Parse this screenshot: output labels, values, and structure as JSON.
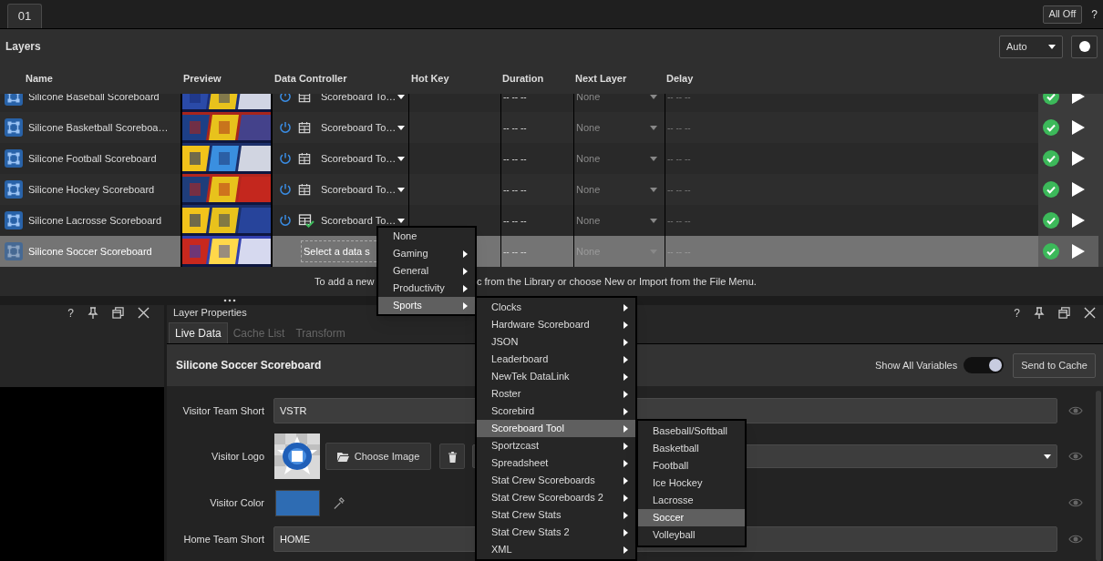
{
  "top_tab": {
    "label": "01",
    "selected": true
  },
  "all_off_button": "All Off",
  "help": "?",
  "layers": {
    "title": "Layers",
    "mode": "Auto"
  },
  "columns": [
    "Name",
    "Preview",
    "Data Controller",
    "Hot Key",
    "Duration",
    "Next Layer",
    "Delay"
  ],
  "rows": [
    {
      "name": "Silicone Baseball Scoreboard",
      "selected": false,
      "controller": {
        "kind": "dropdown",
        "label": "Scoreboard To…",
        "linked": false
      },
      "duration": "-- -- --",
      "next_layer": "None",
      "delay": "-- -- --"
    },
    {
      "name": "Silicone Basketball Scoreboa…",
      "selected": false,
      "controller": {
        "kind": "dropdown",
        "label": "Scoreboard To…",
        "linked": false
      },
      "duration": "-- -- --",
      "next_layer": "None",
      "delay": "-- -- --"
    },
    {
      "name": "Silicone Football Scoreboard",
      "selected": false,
      "controller": {
        "kind": "dropdown",
        "label": "Scoreboard To…",
        "linked": false
      },
      "duration": "-- -- --",
      "next_layer": "None",
      "delay": "-- -- --"
    },
    {
      "name": "Silicone Hockey Scoreboard",
      "selected": false,
      "controller": {
        "kind": "dropdown",
        "label": "Scoreboard To…",
        "linked": false
      },
      "duration": "-- -- --",
      "next_layer": "None",
      "delay": "-- -- --"
    },
    {
      "name": "Silicone Lacrosse Scoreboard",
      "selected": false,
      "controller": {
        "kind": "dropdown",
        "label": "Scoreboard To…",
        "linked": true
      },
      "duration": "-- -- --",
      "next_layer": "None",
      "delay": "-- -- --"
    },
    {
      "name": "Silicone Soccer Scoreboard",
      "selected": true,
      "controller": {
        "kind": "select",
        "placeholder": "Select a data s"
      },
      "duration": "-- -- --",
      "next_layer": "None",
      "delay": "-- -- --"
    }
  ],
  "hint": [
    "To add a new",
    "c from the Library or choose New or Import from the File Menu."
  ],
  "left_panel": {
    "help": "?"
  },
  "properties": {
    "title": "Layer Properties",
    "help": "?",
    "tabs": [
      {
        "label": "Live Data",
        "selected": true
      },
      {
        "label": "Cache List",
        "selected": false
      },
      {
        "label": "Transform",
        "selected": false
      }
    ],
    "layer_name": "Silicone Soccer Scoreboard",
    "show_all_variables": {
      "label": "Show All Variables",
      "on": true
    },
    "send_button": "Send to Cache",
    "fields": [
      {
        "kind": "text",
        "label": "Visitor Team Short",
        "value": "VSTR"
      },
      {
        "label": "Visitor Logo",
        "button": "Choose Image"
      },
      {
        "kind": "color",
        "label": "Visitor Color",
        "color": "#2e6cb3"
      },
      {
        "kind": "text",
        "label": "Home Team Short",
        "value": "HOME"
      }
    ]
  },
  "menus": [
    {
      "items": [
        {
          "label": "None",
          "submenu": false,
          "selected": false
        },
        {
          "label": "Gaming",
          "submenu": true,
          "selected": false
        },
        {
          "label": "General",
          "submenu": true,
          "selected": false
        },
        {
          "label": "Productivity",
          "submenu": true,
          "selected": false
        },
        {
          "label": "Sports",
          "submenu": true,
          "selected": true
        }
      ]
    },
    {
      "items": [
        {
          "label": "Clocks",
          "submenu": true,
          "selected": false
        },
        {
          "label": "Hardware Scoreboard",
          "submenu": true,
          "selected": false
        },
        {
          "label": "JSON",
          "submenu": true,
          "selected": false
        },
        {
          "label": "Leaderboard",
          "submenu": true,
          "selected": false
        },
        {
          "label": "NewTek DataLink",
          "submenu": true,
          "selected": false
        },
        {
          "label": "Roster",
          "submenu": true,
          "selected": false
        },
        {
          "label": "Scorebird",
          "submenu": true,
          "selected": false
        },
        {
          "label": "Scoreboard Tool",
          "submenu": true,
          "selected": true
        },
        {
          "label": "Sportzcast",
          "submenu": true,
          "selected": false
        },
        {
          "label": "Spreadsheet",
          "submenu": true,
          "selected": false
        },
        {
          "label": "Stat Crew Scoreboards",
          "submenu": true,
          "selected": false
        },
        {
          "label": "Stat Crew Scoreboards 2",
          "submenu": true,
          "selected": false
        },
        {
          "label": "Stat Crew Stats",
          "submenu": true,
          "selected": false
        },
        {
          "label": "Stat Crew Stats 2",
          "submenu": true,
          "selected": false
        },
        {
          "label": "XML",
          "submenu": true,
          "selected": false
        }
      ]
    },
    {
      "items": [
        {
          "label": "Baseball/Softball",
          "submenu": false,
          "selected": false
        },
        {
          "label": "Basketball",
          "submenu": false,
          "selected": false
        },
        {
          "label": "Football",
          "submenu": false,
          "selected": false
        },
        {
          "label": "Ice Hockey",
          "submenu": false,
          "selected": false
        },
        {
          "label": "Lacrosse",
          "submenu": false,
          "selected": false
        },
        {
          "label": "Soccer",
          "submenu": false,
          "selected": true
        },
        {
          "label": "Volleyball",
          "submenu": false,
          "selected": false
        }
      ]
    }
  ]
}
